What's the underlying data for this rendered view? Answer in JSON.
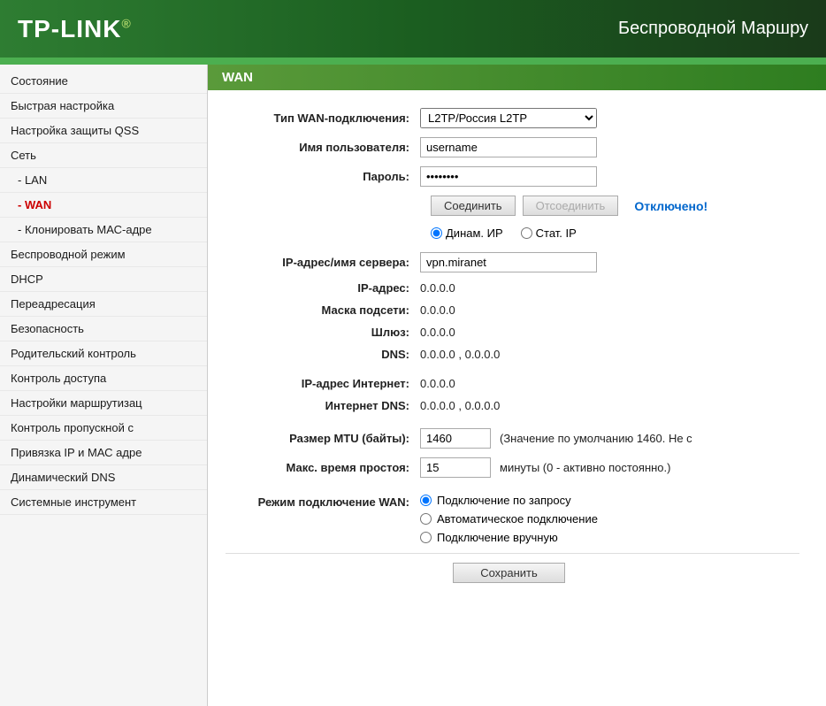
{
  "header": {
    "logo": "TP-LINK",
    "logo_accent": "®",
    "title": "Беспроводной Маршру"
  },
  "sidebar": {
    "items": [
      {
        "label": "Состояние",
        "id": "status",
        "active": false,
        "sub": false
      },
      {
        "label": "Быстрая настройка",
        "id": "quick-setup",
        "active": false,
        "sub": false
      },
      {
        "label": "Настройка защиты QSS",
        "id": "qss",
        "active": false,
        "sub": false
      },
      {
        "label": "Сеть",
        "id": "network",
        "active": false,
        "sub": false
      },
      {
        "label": "- LAN",
        "id": "lan",
        "active": false,
        "sub": true
      },
      {
        "label": "- WAN",
        "id": "wan",
        "active": true,
        "sub": true
      },
      {
        "label": "- Клонировать МАС-адре",
        "id": "mac-clone",
        "active": false,
        "sub": true
      },
      {
        "label": "Беспроводной режим",
        "id": "wireless",
        "active": false,
        "sub": false
      },
      {
        "label": "DHCP",
        "id": "dhcp",
        "active": false,
        "sub": false
      },
      {
        "label": "Переадресация",
        "id": "forwarding",
        "active": false,
        "sub": false
      },
      {
        "label": "Безопасность",
        "id": "security",
        "active": false,
        "sub": false
      },
      {
        "label": "Родительский контроль",
        "id": "parental",
        "active": false,
        "sub": false
      },
      {
        "label": "Контроль доступа",
        "id": "access-control",
        "active": false,
        "sub": false
      },
      {
        "label": "Настройки маршрутизац",
        "id": "routing",
        "active": false,
        "sub": false
      },
      {
        "label": "Контроль пропускной с",
        "id": "bandwidth",
        "active": false,
        "sub": false
      },
      {
        "label": "Привязка IP и МАС адре",
        "id": "ip-mac",
        "active": false,
        "sub": false
      },
      {
        "label": "Динамический DNS",
        "id": "ddns",
        "active": false,
        "sub": false
      },
      {
        "label": "Системные инструмент",
        "id": "system-tools",
        "active": false,
        "sub": false
      }
    ]
  },
  "content": {
    "title": "WAN",
    "wan_type_label": "Тип WAN-подключения:",
    "wan_type_value": "L2TP/Россия L2TP",
    "username_label": "Имя пользователя:",
    "username_value": "username",
    "password_label": "Пароль:",
    "password_value": "••••••••",
    "btn_connect": "Соединить",
    "btn_disconnect": "Отсоединить",
    "status": "Отключено!",
    "dynamic_ip_label": "Динам. ИP",
    "static_ip_label": "Стат. IP",
    "server_ip_label": "IP-адрес/имя сервера:",
    "server_ip_value": "vpn.miranet",
    "ip_label": "IP-адрес:",
    "ip_value": "0.0.0.0",
    "subnet_label": "Маска подсети:",
    "subnet_value": "0.0.0.0",
    "gateway_label": "Шлюз:",
    "gateway_value": "0.0.0.0",
    "dns_label": "DNS:",
    "dns_value": "0.0.0.0 , 0.0.0.0",
    "internet_ip_label": "IP-адрес Интернет:",
    "internet_ip_value": "0.0.0.0",
    "internet_dns_label": "Интернет DNS:",
    "internet_dns_value": "0.0.0.0 , 0.0.0.0",
    "mtu_label": "Размер MTU (байты):",
    "mtu_value": "1460",
    "mtu_hint": "(Значение по умолчанию 1460. Не с",
    "idle_label": "Макс. время простоя:",
    "idle_value": "15",
    "idle_hint": "минуты (0 - активно постоянно.)",
    "mode_label": "Режим подключение WAN:",
    "mode_option1": "Подключение по запросу",
    "mode_option2": "Автоматическое подключение",
    "mode_option3": "Подключение вручную",
    "btn_save": "Сохранить"
  }
}
